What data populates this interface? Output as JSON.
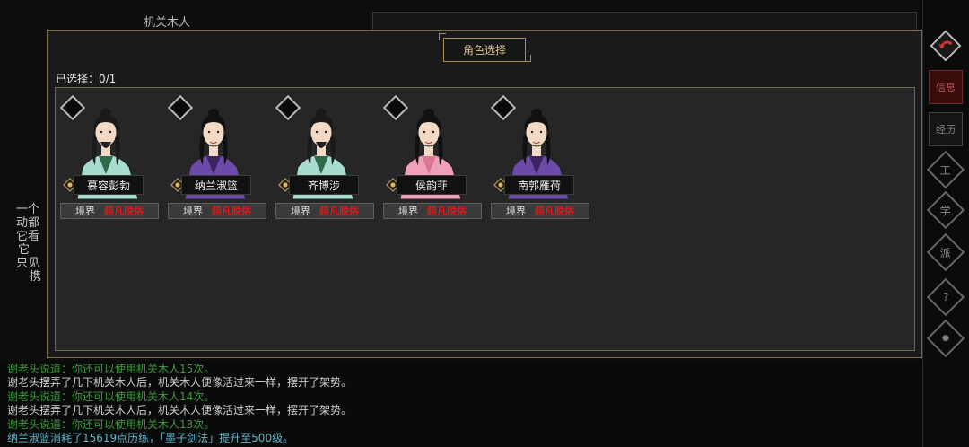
{
  "background": {
    "top_title": "机关木人",
    "left_text_lines": [
      "一个",
      "动都",
      "它看",
      "它",
      "只见",
      "携"
    ]
  },
  "modal": {
    "title": "角色选择",
    "selected_label": "已选择：0/1",
    "characters": [
      {
        "name": "慕容彭勃",
        "realm_label": "境界",
        "realm_value": "超凡脱俗",
        "robe": "#a8dccf",
        "robe2": "#2f6a4a",
        "beard": true
      },
      {
        "name": "纳兰淑篮",
        "realm_label": "境界",
        "realm_value": "超凡脱俗",
        "robe": "#6b4aa8",
        "robe2": "#3a2560",
        "beard": false
      },
      {
        "name": "齐博涉",
        "realm_label": "境界",
        "realm_value": "超凡脱俗",
        "robe": "#a8dccf",
        "robe2": "#2f6a4a",
        "beard": true
      },
      {
        "name": "侯韵菲",
        "realm_label": "境界",
        "realm_value": "超凡脱俗",
        "robe": "#f0a0b8",
        "robe2": "#d87895",
        "beard": false
      },
      {
        "name": "南郭雁荷",
        "realm_label": "境界",
        "realm_value": "超凡脱俗",
        "robe": "#6b4aa8",
        "robe2": "#3a2560",
        "beard": false
      }
    ]
  },
  "sidebar": {
    "items": [
      {
        "label": "",
        "type": "diamond-arrow"
      },
      {
        "label": "信息",
        "type": "box-active"
      },
      {
        "label": "经历",
        "type": "box"
      },
      {
        "label": "工",
        "type": "diamond"
      },
      {
        "label": "学",
        "type": "diamond"
      },
      {
        "label": "派",
        "type": "diamond"
      },
      {
        "label": "?",
        "type": "diamond"
      },
      {
        "label": "✹",
        "type": "diamond"
      }
    ]
  },
  "log": [
    {
      "text": "谢老头说道：你还可以使用机关木人15次。",
      "color": "green"
    },
    {
      "text": "谢老头摆弄了几下机关木人后，机关木人便像活过来一样，摆开了架势。",
      "color": "white"
    },
    {
      "text": "谢老头说道：你还可以使用机关木人14次。",
      "color": "green"
    },
    {
      "text": "谢老头摆弄了几下机关木人后，机关木人便像活过来一样，摆开了架势。",
      "color": "white"
    },
    {
      "text": "谢老头说道：你还可以使用机关木人13次。",
      "color": "green"
    },
    {
      "text": "纳兰淑篮消耗了15619点历练，「墨子剑法」提升至500级。",
      "color": "cyan"
    }
  ]
}
